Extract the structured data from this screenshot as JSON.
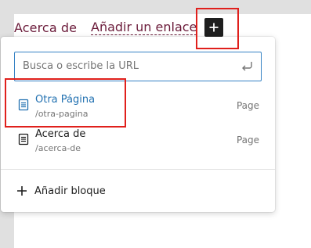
{
  "navigation": {
    "items": [
      {
        "label": "Acerca de"
      },
      {
        "label": "Añadir un enlace"
      }
    ],
    "add_button_icon": "plus-icon"
  },
  "link_popover": {
    "search": {
      "placeholder": "Busca o escribe la URL",
      "value": "",
      "submit_icon": "enter-icon"
    },
    "results": [
      {
        "title": "Otra Página",
        "url": "/otra-pagina",
        "type": "Page",
        "icon": "page-icon"
      },
      {
        "title": "Acerca de",
        "url": "/acerca-de",
        "type": "Page",
        "icon": "page-icon"
      }
    ],
    "add_block": {
      "label": "Añadir bloque",
      "icon": "plus-icon"
    }
  },
  "colors": {
    "accent": "#3582c4",
    "link_active": "#2271b1",
    "nav_text": "#6b1b3a",
    "highlight": "#e0201c"
  }
}
